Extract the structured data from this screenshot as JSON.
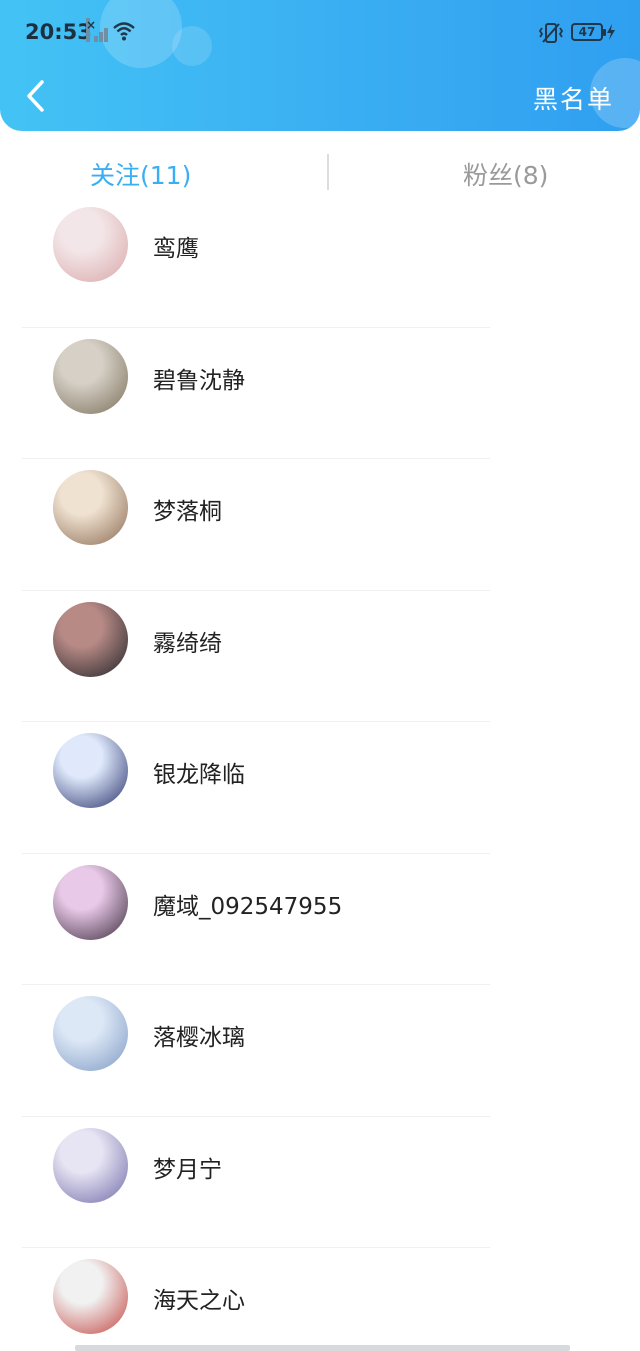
{
  "status_bar": {
    "time": "20:53",
    "battery": "47",
    "signal_icon": "signal-icon",
    "wifi_icon": "wifi-icon",
    "vibrate_icon": "vibrate-icon",
    "charging_icon": "charging-icon"
  },
  "header": {
    "back_icon": "back-chevron-icon",
    "blacklist_label": "黑名单",
    "accent_color": "#3aaef2"
  },
  "tabs": [
    {
      "label": "关注(11)",
      "active": true
    },
    {
      "label": "粉丝(8)",
      "active": false
    }
  ],
  "follow_list": [
    {
      "name": "鸾鹰",
      "avatar_colors": [
        "#f3e6e8",
        "#d9a7a8"
      ]
    },
    {
      "name": "碧鲁沈静",
      "avatar_colors": [
        "#d6d0c6",
        "#7b6f5a"
      ]
    },
    {
      "name": "梦落桐",
      "avatar_colors": [
        "#efe2d0",
        "#8a6a53"
      ]
    },
    {
      "name": "霧绮绮",
      "avatar_colors": [
        "#b88a86",
        "#1f2326"
      ]
    },
    {
      "name": "银龙降临",
      "avatar_colors": [
        "#dfe9fb",
        "#26306a"
      ]
    },
    {
      "name": "魔域_092547955",
      "avatar_colors": [
        "#e9c9e8",
        "#3a2b3c"
      ]
    },
    {
      "name": "落樱冰璃",
      "avatar_colors": [
        "#dde8f6",
        "#7e9ac4"
      ]
    },
    {
      "name": "梦月宁",
      "avatar_colors": [
        "#e7e4f3",
        "#6f6aa8"
      ]
    },
    {
      "name": "海天之心",
      "avatar_colors": [
        "#f1f1f1",
        "#c1443f"
      ]
    }
  ]
}
